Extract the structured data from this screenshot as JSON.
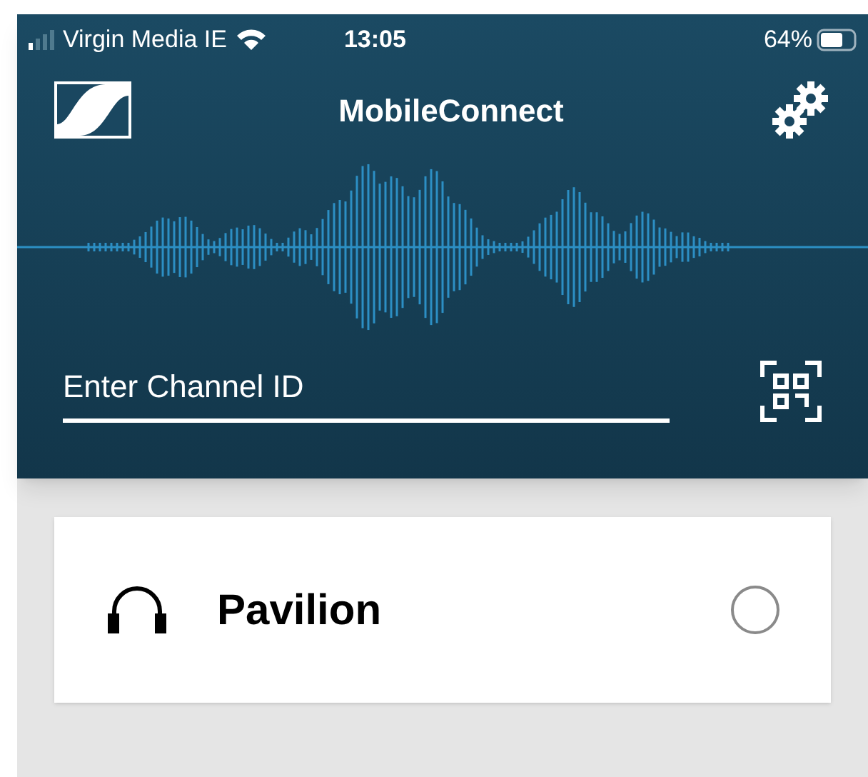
{
  "status_bar": {
    "carrier": "Virgin Media IE",
    "time": "13:05",
    "battery": "64%"
  },
  "header": {
    "title": "MobileConnect"
  },
  "channel_field": {
    "placeholder": "Enter Channel ID"
  },
  "channels": [
    {
      "name": "Pavilion",
      "selected": false
    }
  ]
}
